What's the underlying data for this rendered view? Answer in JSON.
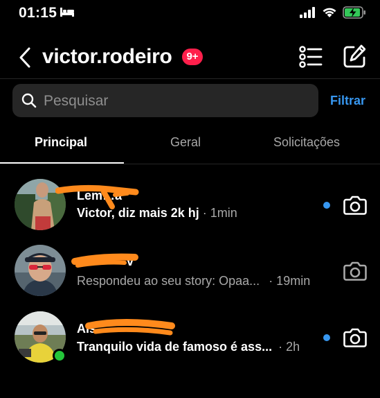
{
  "status_bar": {
    "time": "01:15"
  },
  "header": {
    "username": "victor.rodeiro",
    "badge": "9+"
  },
  "search": {
    "placeholder": "Pesquisar",
    "filter_label": "Filtrar"
  },
  "tabs": [
    {
      "label": "Principal",
      "active": true
    },
    {
      "label": "Geral",
      "active": false
    },
    {
      "label": "Solicitações",
      "active": false
    }
  ],
  "threads": [
    {
      "name": "Lem…a",
      "preview": "Victor, diz mais 2k hj",
      "time": "· 1min",
      "unread": true,
      "online": false
    },
    {
      "name": "v",
      "preview": "Respondeu ao seu story: Opaa...",
      "time": "· 19min",
      "unread": false,
      "online": false
    },
    {
      "name": "Ais",
      "preview": "Tranquilo vida de famoso é ass...",
      "time": "· 2h",
      "unread": true,
      "online": true
    }
  ],
  "colors": {
    "accent_blue": "#3797f0",
    "badge_red": "#ff1f4b",
    "online_green": "#24c53a",
    "redaction_orange": "#ff8a1c"
  }
}
